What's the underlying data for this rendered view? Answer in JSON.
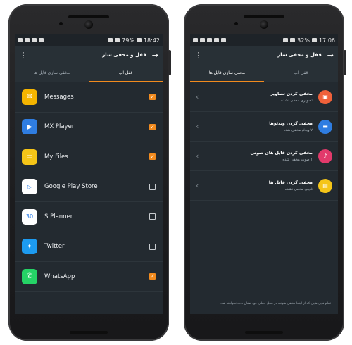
{
  "left": {
    "status": {
      "battery": "79%",
      "time": "18:42"
    },
    "appbar": {
      "title": "قفل و مخفی ساز",
      "menu_icon": "⋮",
      "back_icon": "→"
    },
    "tabs": [
      {
        "label": "قفل اپ",
        "active": true
      },
      {
        "label": "مخفی سازی فایل ها",
        "active": false
      }
    ],
    "apps": [
      {
        "name": "Messages",
        "icon": "✉",
        "color": "#f4b400",
        "checked": true
      },
      {
        "name": "MX Player",
        "icon": "▶",
        "color": "#2f7de1",
        "checked": true
      },
      {
        "name": "My Files",
        "icon": "▭",
        "color": "#f5c518",
        "checked": true
      },
      {
        "name": "Google Play Store",
        "icon": "▷",
        "color": "#ffffff",
        "checked": false
      },
      {
        "name": "S Planner",
        "icon": "30",
        "color": "#ffffff",
        "checked": false
      },
      {
        "name": "Twitter",
        "icon": "✦",
        "color": "#1d9bf0",
        "checked": false
      },
      {
        "name": "WhatsApp",
        "icon": "✆",
        "color": "#25d366",
        "checked": true
      }
    ],
    "check_mark": "✓"
  },
  "right": {
    "status": {
      "battery": "32%",
      "time": "17:06"
    },
    "appbar": {
      "title": "قفل و مخفی ساز",
      "menu_icon": "⋮",
      "back_icon": "→"
    },
    "tabs": [
      {
        "label": "قفل اپ",
        "active": false
      },
      {
        "label": "مخفی سازی فایل ها",
        "active": true
      }
    ],
    "items": [
      {
        "title": "مخفی کردن تصاویر",
        "subtitle": "تصویری مخفی نشده",
        "icon": "▣",
        "color": "#f0613a"
      },
      {
        "title": "مخفی کردن ویدئوها",
        "subtitle": "۷ ویدئو مخفی شده",
        "icon": "▬",
        "color": "#2f7de1"
      },
      {
        "title": "مخفی کردن فایل های صوتی",
        "subtitle": "۱ صوت مخفی شده",
        "icon": "♪",
        "color": "#e23a6b"
      },
      {
        "title": "مخفی کردن فایل ها",
        "subtitle": "فایلی مخفی نشده",
        "icon": "▤",
        "color": "#f5c518"
      }
    ],
    "chevron": "‹",
    "footer": "تمام فایل هایی که از اینجا مخفی شوند، در محل اصلی خود نشان داده نخواهند شد."
  }
}
